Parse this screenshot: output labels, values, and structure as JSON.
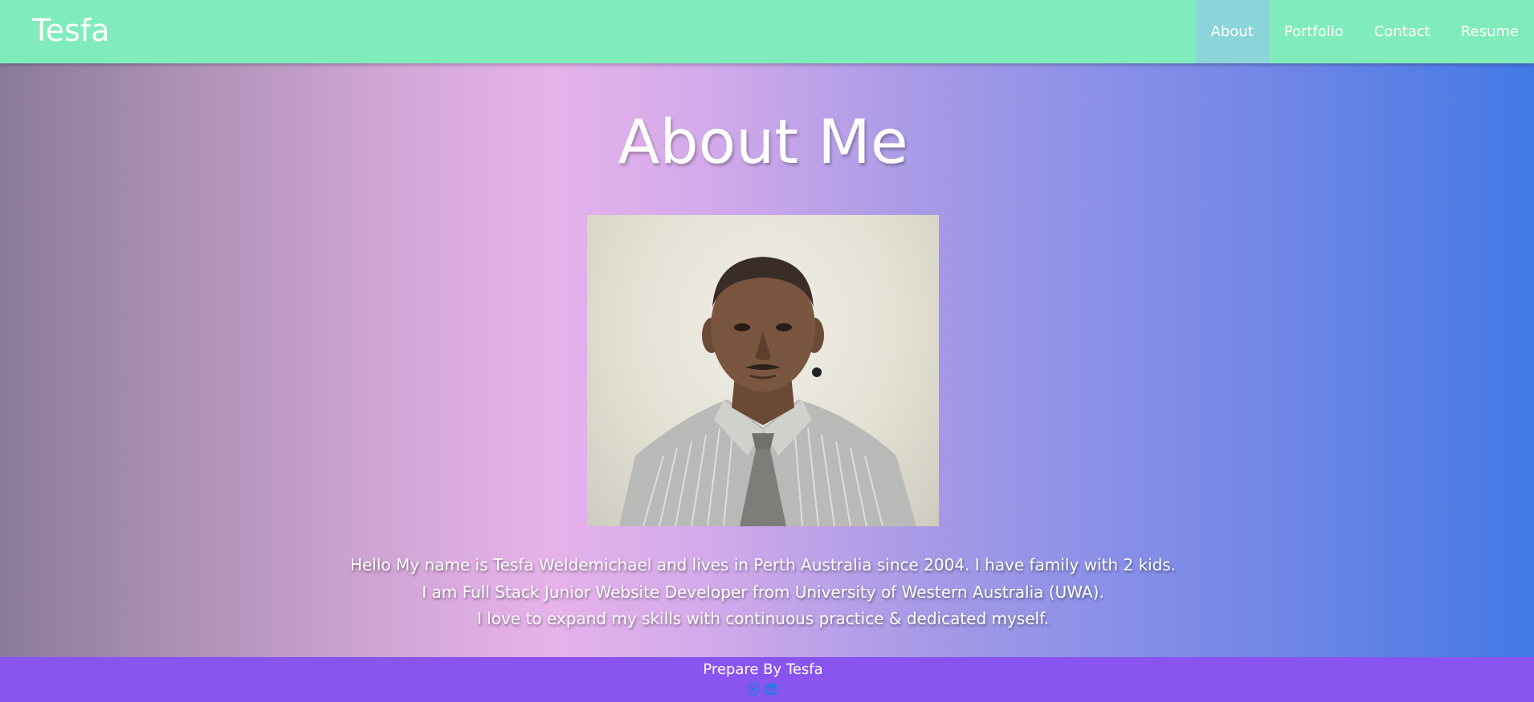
{
  "navbar": {
    "brand": "Tesfa",
    "links": [
      {
        "label": "About",
        "active": true
      },
      {
        "label": "Portfolio",
        "active": false
      },
      {
        "label": "Contact",
        "active": false
      },
      {
        "label": "Resume",
        "active": false
      }
    ]
  },
  "main": {
    "title": "About Me",
    "bio_lines": [
      "Hello My name is Tesfa Weldemichael and lives in Perth Australia since 2004. I have family with 2 kids.",
      "I am Full Stack Junior Website Developer from University of Western Australia (UWA).",
      "I love to expand my skills with continuous practice & dedicated myself."
    ]
  },
  "footer": {
    "text": "Prepare By Tesfa",
    "icons": [
      "github-icon",
      "linkedin-icon"
    ]
  },
  "colors": {
    "navbar": "#80ecbb",
    "nav_active": "#8bd4da",
    "footer": "#8a54f0",
    "icon": "#2a79e8"
  }
}
